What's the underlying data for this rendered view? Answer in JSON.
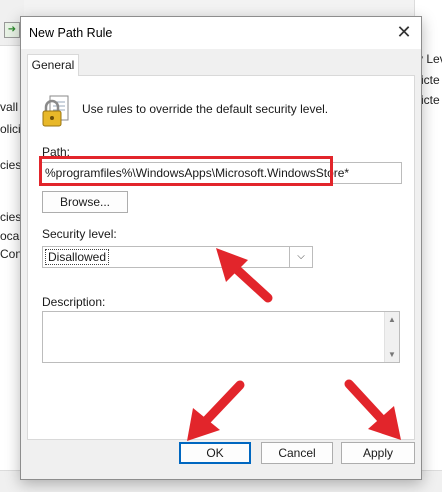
{
  "background": {
    "left_fragments": [
      "vall s",
      "olici",
      "cies",
      "cies",
      "ocal",
      "Cont"
    ],
    "right_fragments": [
      "y Lev",
      "ricte",
      "ricte"
    ]
  },
  "dialog": {
    "title": "New Path Rule",
    "close_glyph": "✕",
    "tab_general": "General",
    "info_text": "Use rules to override the default security level.",
    "path_label": "Path:",
    "path_value": "%programfiles%\\WindowsApps\\Microsoft.WindowsStore*",
    "browse_label": "Browse...",
    "security_label": "Security level:",
    "security_value": "Disallowed",
    "description_label": "Description:",
    "description_value": "",
    "ok_label": "OK",
    "cancel_label": "Cancel",
    "apply_label": "Apply"
  },
  "annotation": {
    "highlight_color": "#e2252b",
    "arrow_color": "#e2252b"
  },
  "icons": {
    "lock": "lock-document-icon",
    "close": "close-icon",
    "dropdown": "chevron-down-icon"
  }
}
